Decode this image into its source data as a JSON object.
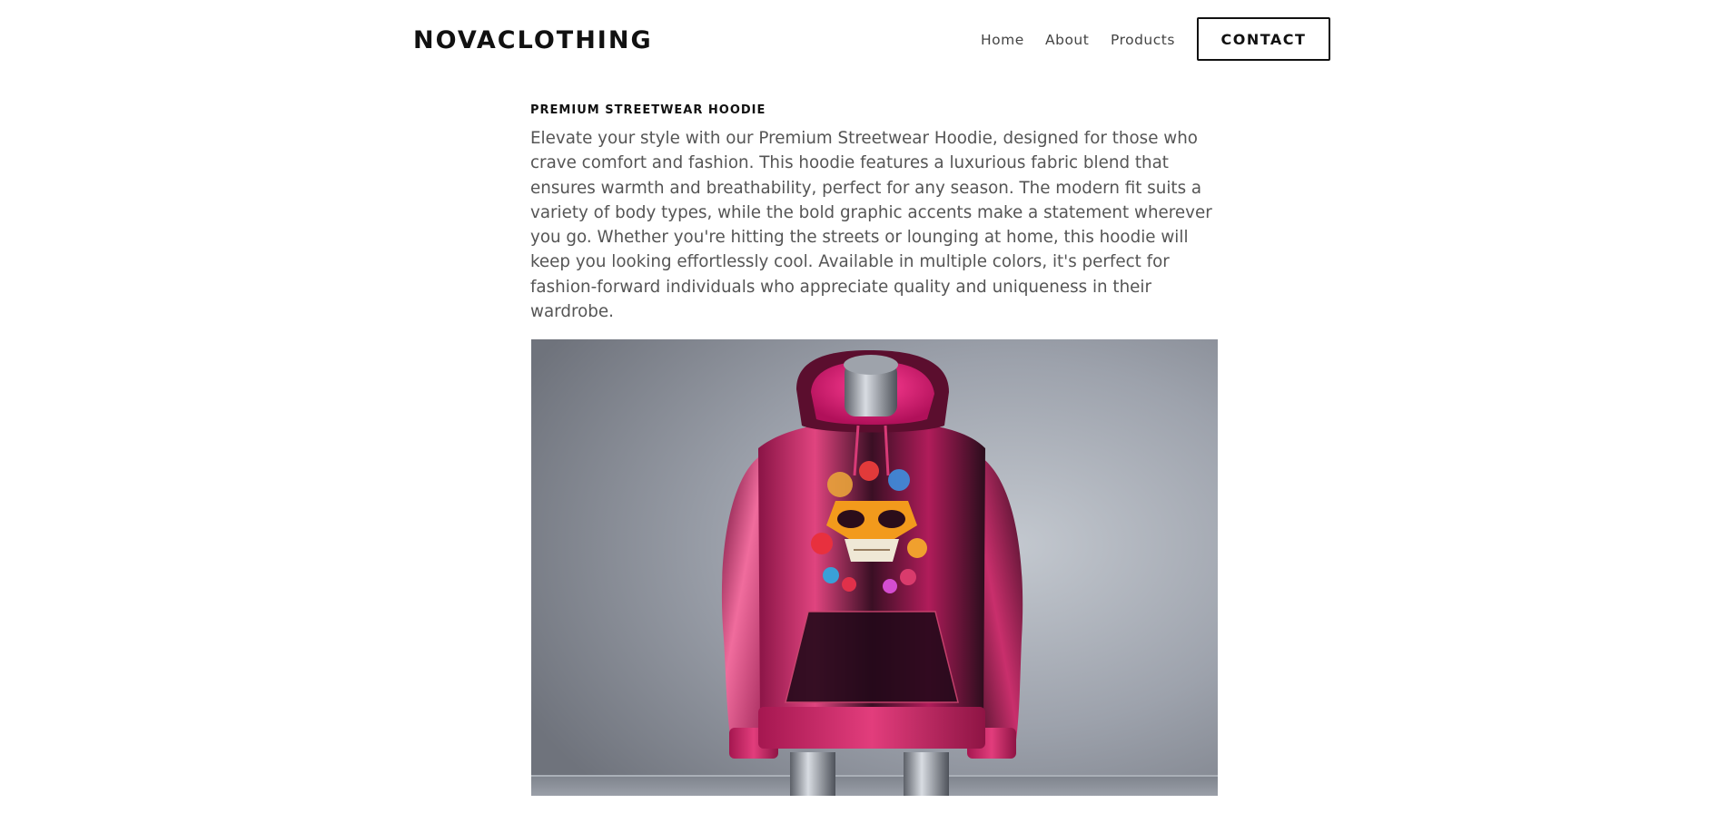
{
  "brand": {
    "name": "NOVACLOTHING"
  },
  "nav": {
    "items": [
      {
        "label": "Home"
      },
      {
        "label": "About"
      },
      {
        "label": "Products"
      }
    ],
    "contact_label": "CONTACT"
  },
  "product": {
    "kicker": "PREMIUM STREETWEAR HOODIE",
    "description": "Elevate your style with our Premium Streetwear Hoodie, designed for those who crave comfort and fashion. This hoodie features a luxurious fabric blend that ensures warmth and breathability, perfect for any season. The modern fit suits a variety of body types, while the bold graphic accents make a statement wherever you go. Whether you're hitting the streets or lounging at home, this hoodie will keep you looking effortlessly cool. Available in multiple colors, it's perfect for fashion-forward individuals who appreciate quality and uniqueness in their wardrobe.",
    "image": {
      "subject": "hoodie-photo",
      "colors": {
        "backdrop": "#8d929c",
        "hoodie_pink": "#d0246a",
        "hoodie_dark": "#2a0d1c",
        "mannequin": "#b9bec6"
      }
    }
  },
  "theme": {
    "text_primary": "#111111",
    "text_body": "#555555",
    "nav_text": "#444444",
    "background": "#ffffff"
  }
}
